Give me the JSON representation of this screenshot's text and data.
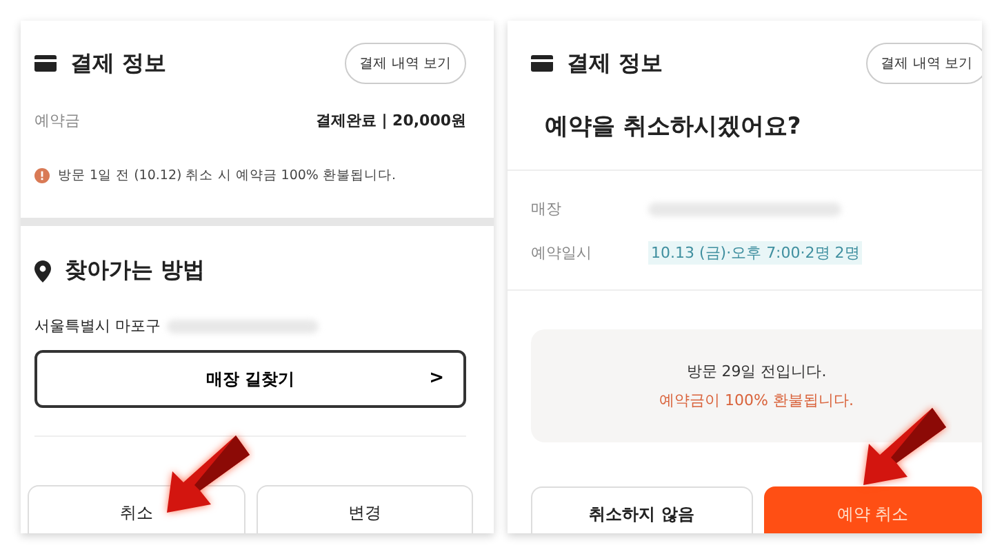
{
  "left_screen": {
    "section_title": "결제 정보",
    "history_button": "결제 내역 보기",
    "deposit_label": "예약금",
    "deposit_value": "결제완료 | 20,000원",
    "refund_notice": "방문 1일 전 (10.12) 취소 시 예약금 100% 환불됩니다.",
    "directions_title": "찾아가는 방법",
    "address": "서울특별시 마포구",
    "route_button": "매장 길찾기",
    "route_chevron": ">",
    "buttons": [
      {
        "label": "취소",
        "kind": "outline"
      },
      {
        "label": "변경",
        "kind": "outline"
      }
    ]
  },
  "right_screen": {
    "section_title": "결제 정보",
    "history_button": "결제 내역 보기",
    "question": "예약을 취소하시겠어요?",
    "details": [
      {
        "label": "매장"
      },
      {
        "label": "예약일시",
        "value": "10.13 (금)·오후 7:00·2명 2명"
      }
    ],
    "notice_lines": [
      {
        "text": "방문 29일 전입니다.",
        "kind": "plain"
      },
      {
        "text": "예약금이 100% 환불됩니다.",
        "kind": "emphasis"
      }
    ],
    "buttons": [
      {
        "label": "취소하지 않음",
        "kind": "outline"
      },
      {
        "label": "예약 취소",
        "kind": "primary"
      }
    ]
  }
}
